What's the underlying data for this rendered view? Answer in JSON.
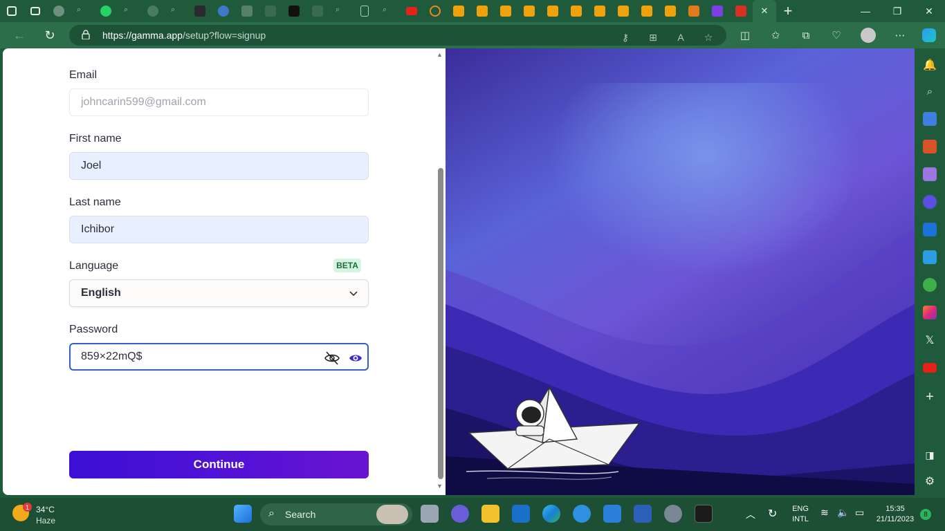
{
  "browser": {
    "url_host": "https://gamma.app",
    "url_path": "/setup?flow=signup",
    "tab_close": "✕",
    "new_tab": "+"
  },
  "form": {
    "email_label": "Email",
    "email_value": "johncarin599@gmail.com",
    "first_name_label": "First name",
    "first_name_value": "Joel",
    "last_name_label": "Last name",
    "last_name_value": "Ichibor",
    "language_label": "Language",
    "language_badge": "BETA",
    "language_value": "English",
    "password_label": "Password",
    "password_value": "859×22mQ$",
    "continue_label": "Continue"
  },
  "taskbar": {
    "weather_badge": "1",
    "temperature": "34°C",
    "condition": "Haze",
    "search_label": "Search",
    "lang_line1": "ENG",
    "lang_line2": "INTL",
    "time": "15:35",
    "date": "21/11/2023",
    "notification_count": "8"
  },
  "colors": {
    "accent": "#4a12d8",
    "browser_frame": "#1f5a3a",
    "focus_border": "#2f5fd0"
  }
}
